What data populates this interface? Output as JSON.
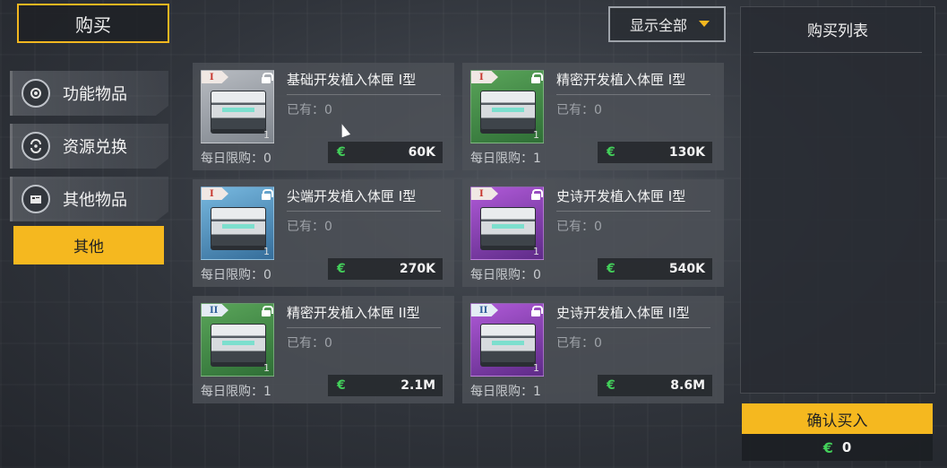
{
  "header": {
    "title": "购买"
  },
  "sidebar": {
    "items": [
      {
        "label": "功能物品",
        "icon": "gear-icon"
      },
      {
        "label": "资源兑换",
        "icon": "exchange-icon"
      },
      {
        "label": "其他物品",
        "icon": "box-icon"
      }
    ],
    "other_label": "其他"
  },
  "filter": {
    "label": "显示全部"
  },
  "items": [
    {
      "tier": "I",
      "name": "基础开发植入体匣 I型",
      "owned": "已有：0",
      "limit": "每日限购：0",
      "price": "60K",
      "qty": "1",
      "rarity": "grey"
    },
    {
      "tier": "I",
      "name": "精密开发植入体匣 I型",
      "owned": "已有：0",
      "limit": "每日限购：1",
      "price": "130K",
      "qty": "1",
      "rarity": "green"
    },
    {
      "tier": "I",
      "name": "尖端开发植入体匣 I型",
      "owned": "已有：0",
      "limit": "每日限购：0",
      "price": "270K",
      "qty": "1",
      "rarity": "blue"
    },
    {
      "tier": "I",
      "name": "史诗开发植入体匣 I型",
      "owned": "已有：0",
      "limit": "每日限购：0",
      "price": "540K",
      "qty": "1",
      "rarity": "purple"
    },
    {
      "tier": "II",
      "name": "精密开发植入体匣 II型",
      "owned": "已有：0",
      "limit": "每日限购：1",
      "price": "2.1M",
      "qty": "1",
      "rarity": "green"
    },
    {
      "tier": "II",
      "name": "史诗开发植入体匣 II型",
      "owned": "已有：0",
      "limit": "每日限购：1",
      "price": "8.6M",
      "qty": "1",
      "rarity": "purple"
    }
  ],
  "currency_symbol": "€",
  "purchase_list": {
    "title": "购买列表",
    "confirm_label": "确认买入",
    "total": "0"
  },
  "colors": {
    "accent": "#f5b81f",
    "currency": "#43d05a"
  }
}
